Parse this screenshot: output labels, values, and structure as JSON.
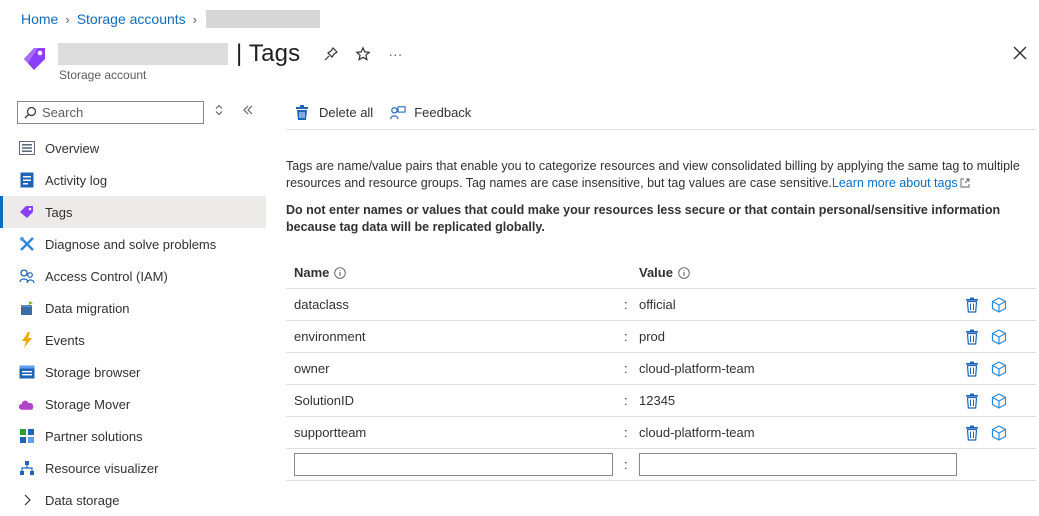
{
  "breadcrumb": {
    "home": "Home",
    "storage_accounts": "Storage accounts"
  },
  "header": {
    "title": "| Tags",
    "subtitle": "Storage account",
    "more": "···"
  },
  "sidebar": {
    "search_placeholder": "Search",
    "items": [
      {
        "label": "Overview",
        "icon": "overview-icon"
      },
      {
        "label": "Activity log",
        "icon": "activity-log-icon"
      },
      {
        "label": "Tags",
        "icon": "tag-icon",
        "active": true
      },
      {
        "label": "Diagnose and solve problems",
        "icon": "diagnose-icon"
      },
      {
        "label": "Access Control (IAM)",
        "icon": "people-icon"
      },
      {
        "label": "Data migration",
        "icon": "data-migration-icon"
      },
      {
        "label": "Events",
        "icon": "lightning-icon"
      },
      {
        "label": "Storage browser",
        "icon": "storage-browser-icon"
      },
      {
        "label": "Storage Mover",
        "icon": "cloud-icon"
      },
      {
        "label": "Partner solutions",
        "icon": "partner-icon"
      },
      {
        "label": "Resource visualizer",
        "icon": "resource-visualizer-icon"
      },
      {
        "label": "Data storage",
        "icon": "chevron-right-icon"
      }
    ]
  },
  "toolbar": {
    "delete_all": "Delete all",
    "feedback": "Feedback"
  },
  "content": {
    "description": "Tags are name/value pairs that enable you to categorize resources and view consolidated billing by applying the same tag to multiple resources and resource groups. Tag names are case insensitive, but tag values are case sensitive.",
    "learn_more": "Learn more about tags",
    "warning": "Do not enter names or values that could make your resources less secure or that contain personal/sensitive information because tag data will be replicated globally."
  },
  "table": {
    "name_header": "Name",
    "value_header": "Value",
    "separator": ":",
    "rows": [
      {
        "name": "dataclass",
        "value": "official"
      },
      {
        "name": "environment",
        "value": "prod"
      },
      {
        "name": "owner",
        "value": "cloud-platform-team"
      },
      {
        "name": "SolutionID",
        "value": "12345"
      },
      {
        "name": "supportteam",
        "value": "cloud-platform-team"
      }
    ],
    "new_name_value": "",
    "new_value_value": ""
  },
  "colors": {
    "link": "#0f6cbd",
    "active_bg": "#edebe9",
    "tag_purple": "#8a3ffc"
  }
}
